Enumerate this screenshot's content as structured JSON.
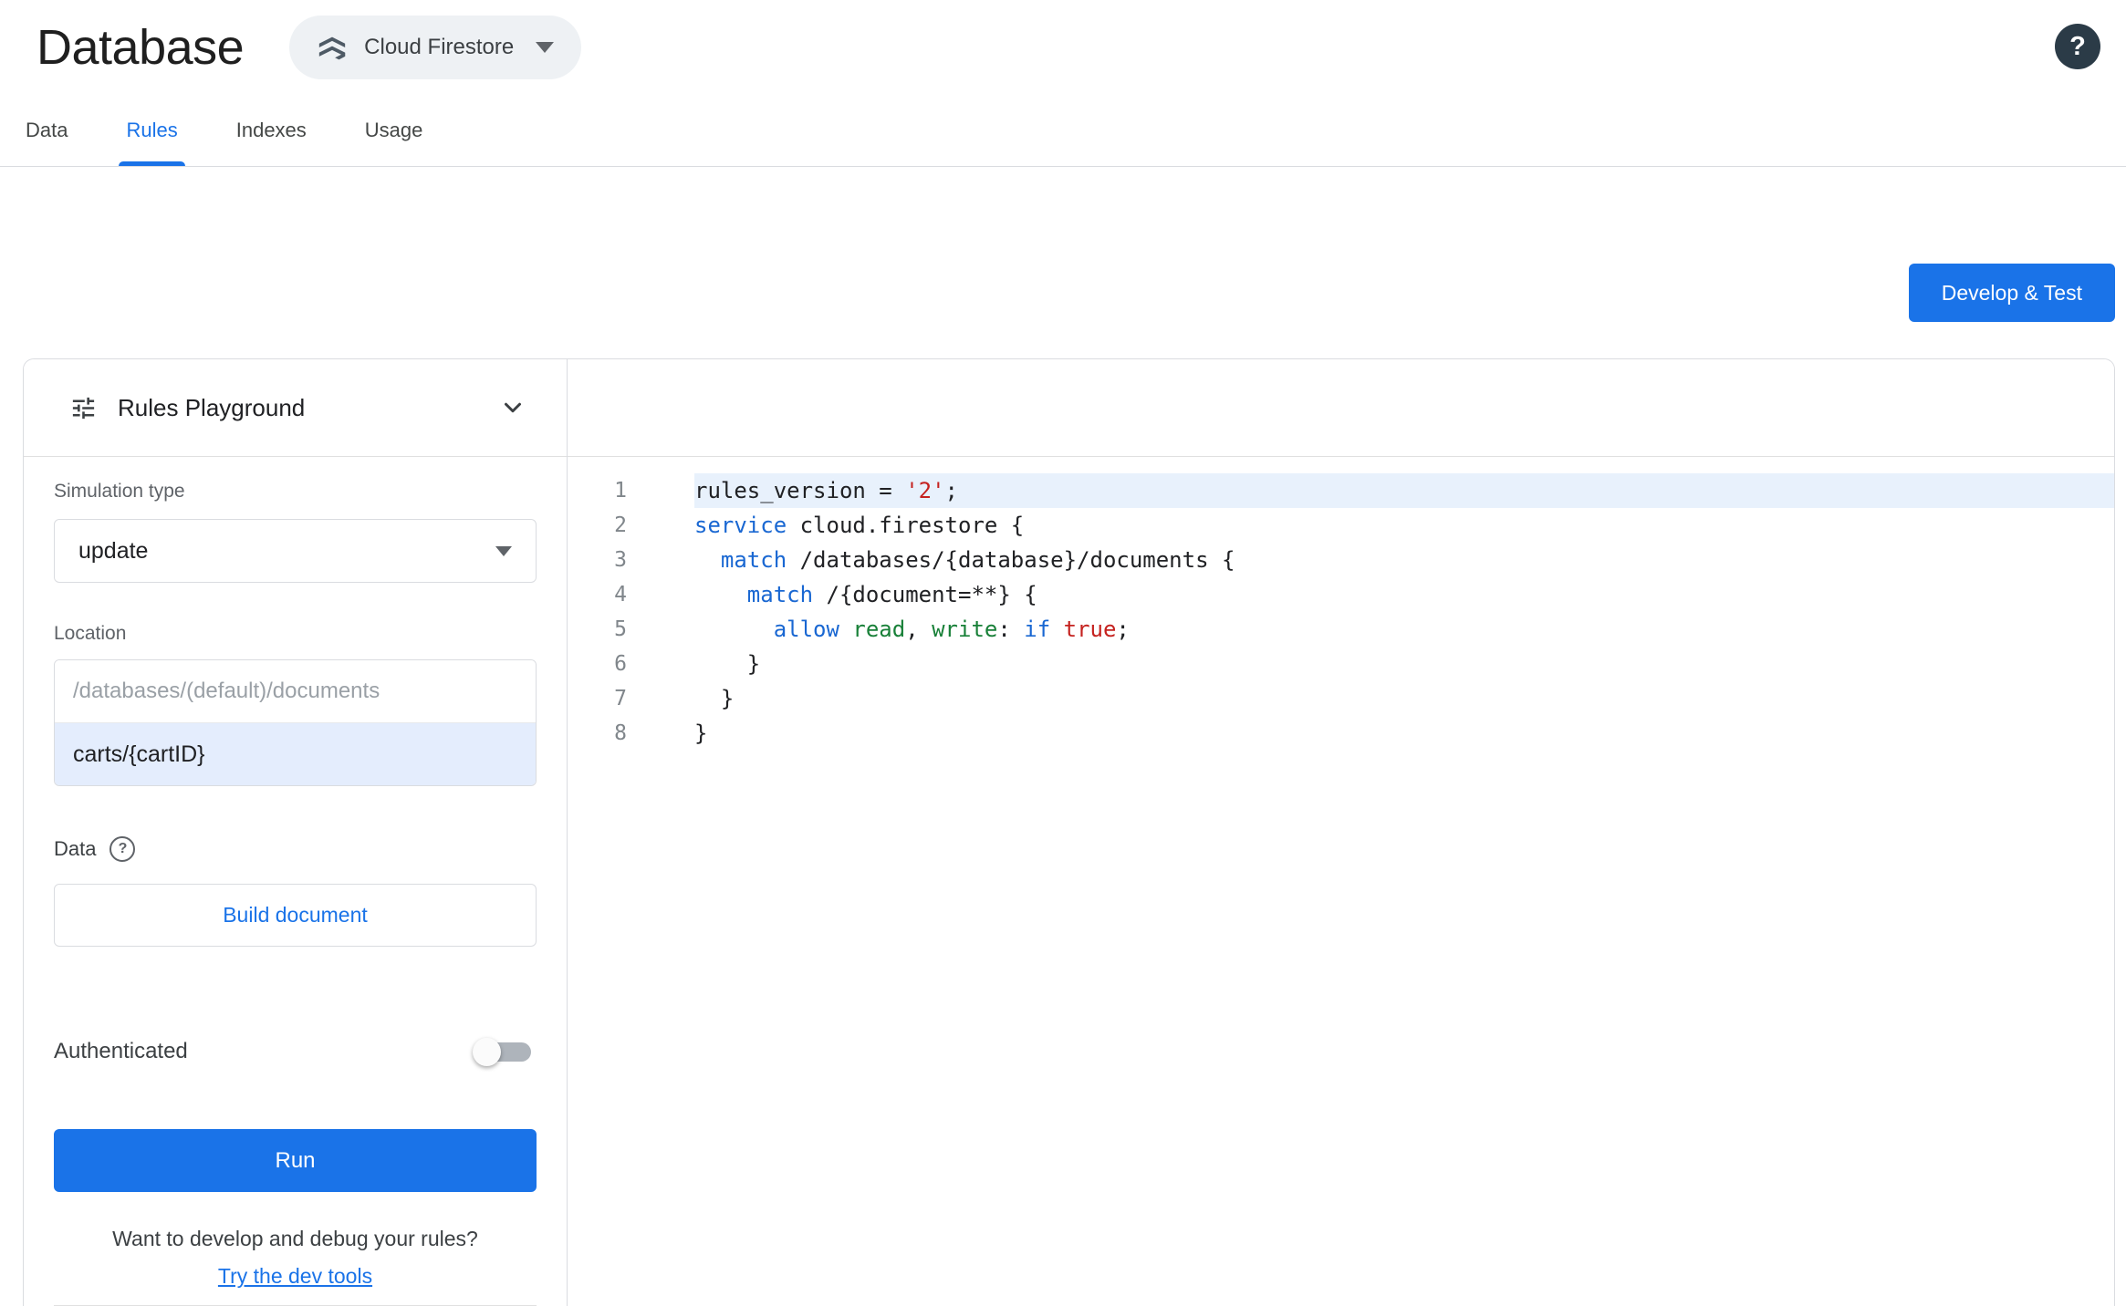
{
  "header": {
    "title": "Database",
    "database_selector": {
      "label": "Cloud Firestore"
    },
    "help": "?"
  },
  "tabs": [
    {
      "label": "Data",
      "active": false
    },
    {
      "label": "Rules",
      "active": true
    },
    {
      "label": "Indexes",
      "active": false
    },
    {
      "label": "Usage",
      "active": false
    }
  ],
  "actions": {
    "develop_test": "Develop & Test"
  },
  "playground": {
    "title": "Rules Playground",
    "simulation_type": {
      "label": "Simulation type",
      "value": "update"
    },
    "location": {
      "label": "Location",
      "placeholder": "/databases/(default)/documents",
      "value": "carts/{cartID}"
    },
    "data_section": {
      "label": "Data",
      "help": "?"
    },
    "build_document": "Build document",
    "authenticated": "Authenticated",
    "authenticated_on": false,
    "run": "Run",
    "helper_text": "Want to develop and debug your rules?",
    "dev_tools_link": "Try the dev tools"
  },
  "editor": {
    "lines": [
      {
        "num": 1,
        "highlight": true,
        "tokens": [
          [
            "rules_version = ",
            "p"
          ],
          [
            "'2'",
            "s"
          ],
          [
            ";",
            "p"
          ]
        ]
      },
      {
        "num": 2,
        "highlight": false,
        "tokens": [
          [
            "service",
            "k"
          ],
          [
            " cloud.firestore {",
            "p"
          ]
        ]
      },
      {
        "num": 3,
        "highlight": false,
        "tokens": [
          [
            "  ",
            "p"
          ],
          [
            "match",
            "k"
          ],
          [
            " /databases/{database}/documents {",
            "p"
          ]
        ]
      },
      {
        "num": 4,
        "highlight": false,
        "tokens": [
          [
            "    ",
            "p"
          ],
          [
            "match",
            "k"
          ],
          [
            " /{document=**} {",
            "p"
          ]
        ]
      },
      {
        "num": 5,
        "highlight": false,
        "tokens": [
          [
            "      ",
            "p"
          ],
          [
            "allow",
            "k"
          ],
          [
            " ",
            "p"
          ],
          [
            "read",
            "g"
          ],
          [
            ", ",
            "p"
          ],
          [
            "write",
            "g"
          ],
          [
            ": ",
            "p"
          ],
          [
            "if",
            "k"
          ],
          [
            " ",
            "p"
          ],
          [
            "true",
            "s"
          ],
          [
            ";",
            "p"
          ]
        ]
      },
      {
        "num": 6,
        "highlight": false,
        "tokens": [
          [
            "    }",
            "p"
          ]
        ]
      },
      {
        "num": 7,
        "highlight": false,
        "tokens": [
          [
            "  }",
            "p"
          ]
        ]
      },
      {
        "num": 8,
        "highlight": false,
        "tokens": [
          [
            "}",
            "p"
          ]
        ]
      }
    ]
  },
  "colors": {
    "accent": "#1a73e8",
    "keyword": "#1967d2",
    "string": "#c5221f",
    "identifier_green": "#188038",
    "line_highlight": "#e8f1fc",
    "border": "#dadce0"
  }
}
